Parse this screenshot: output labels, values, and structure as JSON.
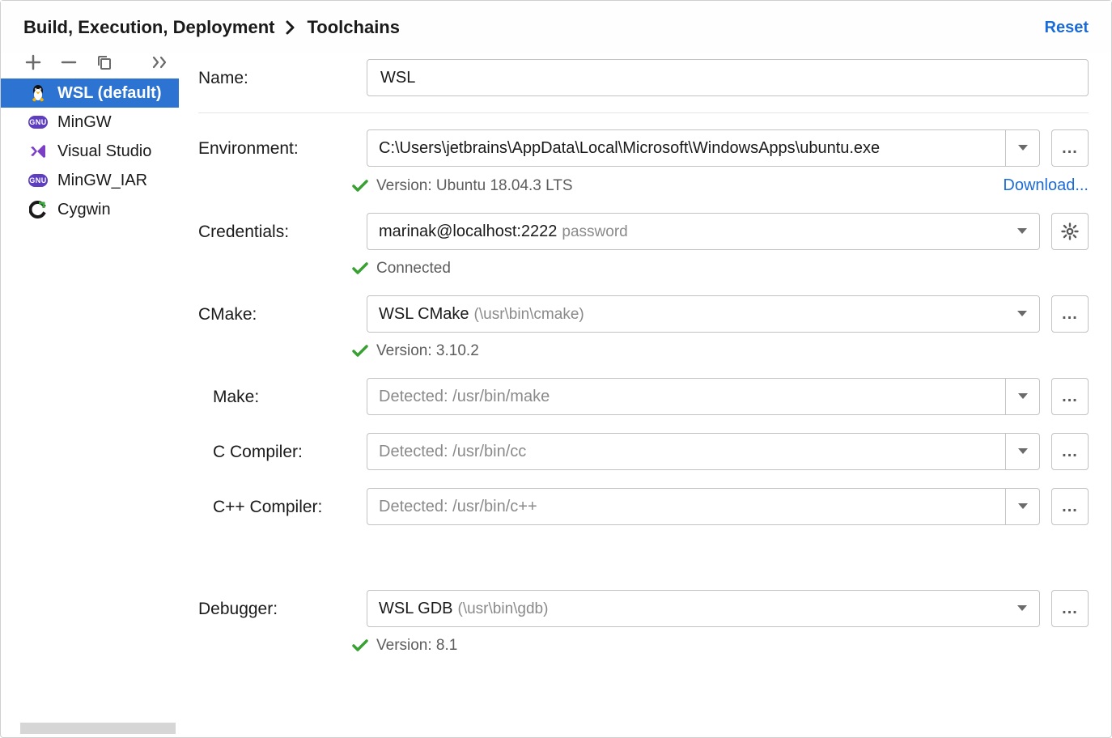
{
  "breadcrumb": {
    "parent": "Build, Execution, Deployment",
    "current": "Toolchains"
  },
  "reset_label": "Reset",
  "sidebar": {
    "items": [
      {
        "label": "WSL (default)",
        "icon": "tux"
      },
      {
        "label": "MinGW",
        "icon": "gnu"
      },
      {
        "label": "Visual Studio",
        "icon": "vs"
      },
      {
        "label": "MinGW_IAR",
        "icon": "gnu"
      },
      {
        "label": "Cygwin",
        "icon": "cyg"
      }
    ]
  },
  "form": {
    "name": {
      "label": "Name:",
      "value": "WSL"
    },
    "environment": {
      "label": "Environment:",
      "value": "C:\\Users\\jetbrains\\AppData\\Local\\Microsoft\\WindowsApps\\ubuntu.exe",
      "status": "Version: Ubuntu 18.04.3 LTS",
      "download": "Download..."
    },
    "credentials": {
      "label": "Credentials:",
      "value": "marinak@localhost:2222",
      "hint": "password",
      "status": "Connected"
    },
    "cmake": {
      "label": "CMake:",
      "value": "WSL CMake",
      "path": "(\\usr\\bin\\cmake)",
      "status": "Version: 3.10.2"
    },
    "make": {
      "label": "Make:",
      "placeholder": "Detected: /usr/bin/make"
    },
    "ccompiler": {
      "label": "C Compiler:",
      "placeholder": "Detected: /usr/bin/cc"
    },
    "cppcompiler": {
      "label": "C++ Compiler:",
      "placeholder": "Detected: /usr/bin/c++"
    },
    "debugger": {
      "label": "Debugger:",
      "value": "WSL GDB",
      "path": "(\\usr\\bin\\gdb)",
      "status": "Version: 8.1"
    }
  }
}
